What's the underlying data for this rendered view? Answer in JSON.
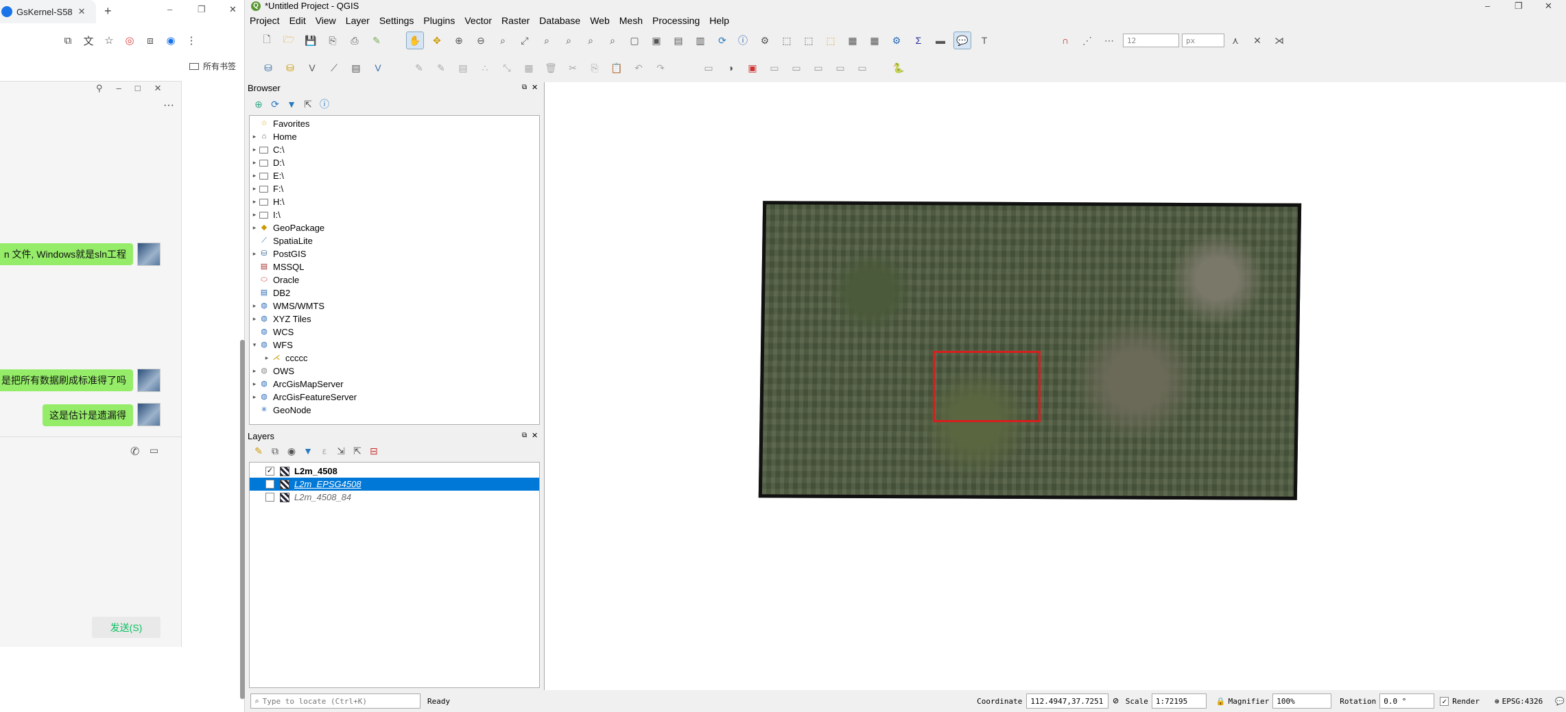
{
  "chrome": {
    "tab_title": "GsKernel-S58",
    "new_tab_symbol": "+",
    "bookmarks_label": "所有书签",
    "window_min": "–",
    "window_restore": "❐",
    "window_close": "✕"
  },
  "chat": {
    "messages": [
      {
        "text": "n 文件, Windows就是sln工程"
      },
      {
        "text": "是把所有数据刷成标准得了吗"
      },
      {
        "text": "这是估计是遗漏得"
      }
    ],
    "send_label": "发送(S)",
    "more_symbol": "···"
  },
  "qgis": {
    "window_title": "*Untitled Project - QGIS",
    "menu": [
      "Project",
      "Edit",
      "View",
      "Layer",
      "Settings",
      "Plugins",
      "Vector",
      "Raster",
      "Database",
      "Web",
      "Mesh",
      "Processing",
      "Help"
    ],
    "font_size_value": "12",
    "font_unit": "px",
    "browser": {
      "title": "Browser",
      "items": [
        {
          "label": "Favorites",
          "icon": "star-icon",
          "expand": ""
        },
        {
          "label": "Home",
          "icon": "home-icon",
          "expand": "▸"
        },
        {
          "label": "C:\\",
          "icon": "folder-icon",
          "expand": "▸"
        },
        {
          "label": "D:\\",
          "icon": "folder-icon",
          "expand": "▸"
        },
        {
          "label": "E:\\",
          "icon": "folder-icon",
          "expand": "▸"
        },
        {
          "label": "F:\\",
          "icon": "folder-icon",
          "expand": "▸"
        },
        {
          "label": "H:\\",
          "icon": "folder-icon",
          "expand": "▸"
        },
        {
          "label": "I:\\",
          "icon": "folder-icon",
          "expand": "▸"
        },
        {
          "label": "GeoPackage",
          "icon": "geopackage-icon",
          "expand": "▸"
        },
        {
          "label": "SpatiaLite",
          "icon": "spatialite-icon",
          "expand": ""
        },
        {
          "label": "PostGIS",
          "icon": "postgis-icon",
          "expand": "▸"
        },
        {
          "label": "MSSQL",
          "icon": "mssql-icon",
          "expand": ""
        },
        {
          "label": "Oracle",
          "icon": "oracle-icon",
          "expand": ""
        },
        {
          "label": "DB2",
          "icon": "db2-icon",
          "expand": ""
        },
        {
          "label": "WMS/WMTS",
          "icon": "globe-icon",
          "expand": "▸"
        },
        {
          "label": "XYZ Tiles",
          "icon": "globe-icon",
          "expand": "▸"
        },
        {
          "label": "WCS",
          "icon": "globe-icon",
          "expand": ""
        },
        {
          "label": "WFS",
          "icon": "globe-icon",
          "expand": "▾"
        },
        {
          "label": "ccccc",
          "icon": "wfs-connection-icon",
          "expand": "▸"
        },
        {
          "label": "OWS",
          "icon": "ows-icon",
          "expand": "▸"
        },
        {
          "label": "ArcGisMapServer",
          "icon": "globe-icon",
          "expand": "▸"
        },
        {
          "label": "ArcGisFeatureServer",
          "icon": "globe-icon",
          "expand": "▸"
        },
        {
          "label": "GeoNode",
          "icon": "geonode-icon",
          "expand": ""
        }
      ]
    },
    "layers": {
      "title": "Layers",
      "items": [
        {
          "name": "L2m_4508",
          "checked": "✓",
          "style": "bold"
        },
        {
          "name": "L2m_EPSG4508",
          "checked": "",
          "style": "italic-selected"
        },
        {
          "name": "L2m_4508_84",
          "checked": "",
          "style": "italic"
        }
      ]
    },
    "statusbar": {
      "locate_placeholder": "Type to locate (Ctrl+K)",
      "ready": "Ready",
      "coordinate_label": "Coordinate",
      "coordinate_value": "112.4947,37.7251",
      "scale_label": "Scale",
      "scale_value": "1:72195",
      "magnifier_label": "Magnifier",
      "magnifier_value": "100%",
      "rotation_label": "Rotation",
      "rotation_value": "0.0 °",
      "render_label": "Render",
      "render_checked": "✓",
      "crs": "EPSG:4326"
    },
    "colors": {
      "selection": "#0078d7",
      "extent_box": "#d71e1e",
      "chat_bubble": "#95ec69"
    }
  }
}
